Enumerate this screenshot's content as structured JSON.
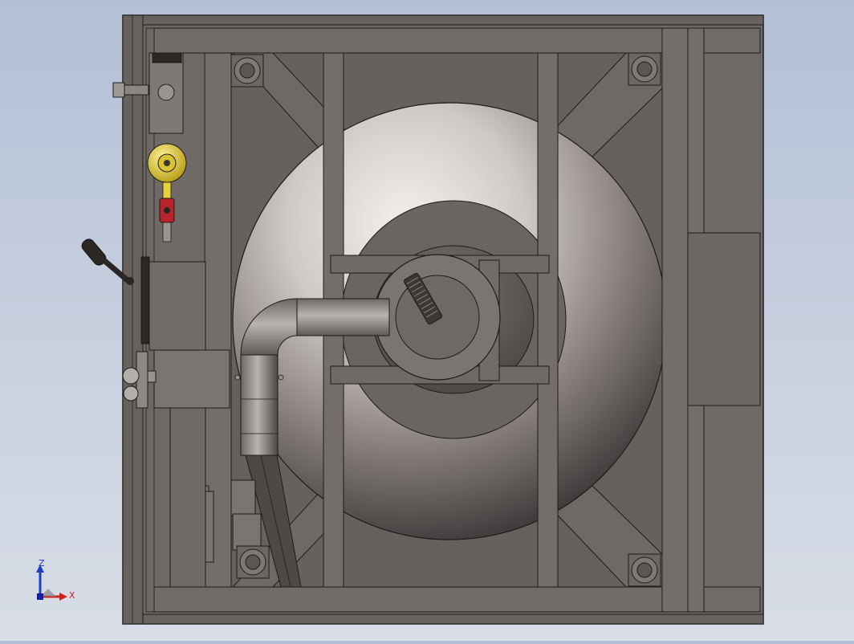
{
  "window": {
    "title": ""
  },
  "colors": {
    "background_top": "#b3bfd6",
    "background_bottom": "#d8dde6",
    "frame": "#6f6a66",
    "frame_dark": "#5f5a56",
    "outline": "#1c1c1c",
    "disc_light": "#e9e7e5",
    "disc_dark": "#3a3634",
    "fitting_yellow": "#e6d23a",
    "fitting_red": "#b8242a",
    "axis_x": "#d02020",
    "axis_z": "#2040c0"
  },
  "triad": {
    "x_label": "X",
    "z_label": "Z"
  },
  "icons": {
    "triad": "xyz-axes-icon",
    "handle": "crank-handle-icon",
    "bolt": "hex-bolt-icon",
    "pipe": "elbow-pipe-icon",
    "valve": "valve-fitting-icon"
  }
}
